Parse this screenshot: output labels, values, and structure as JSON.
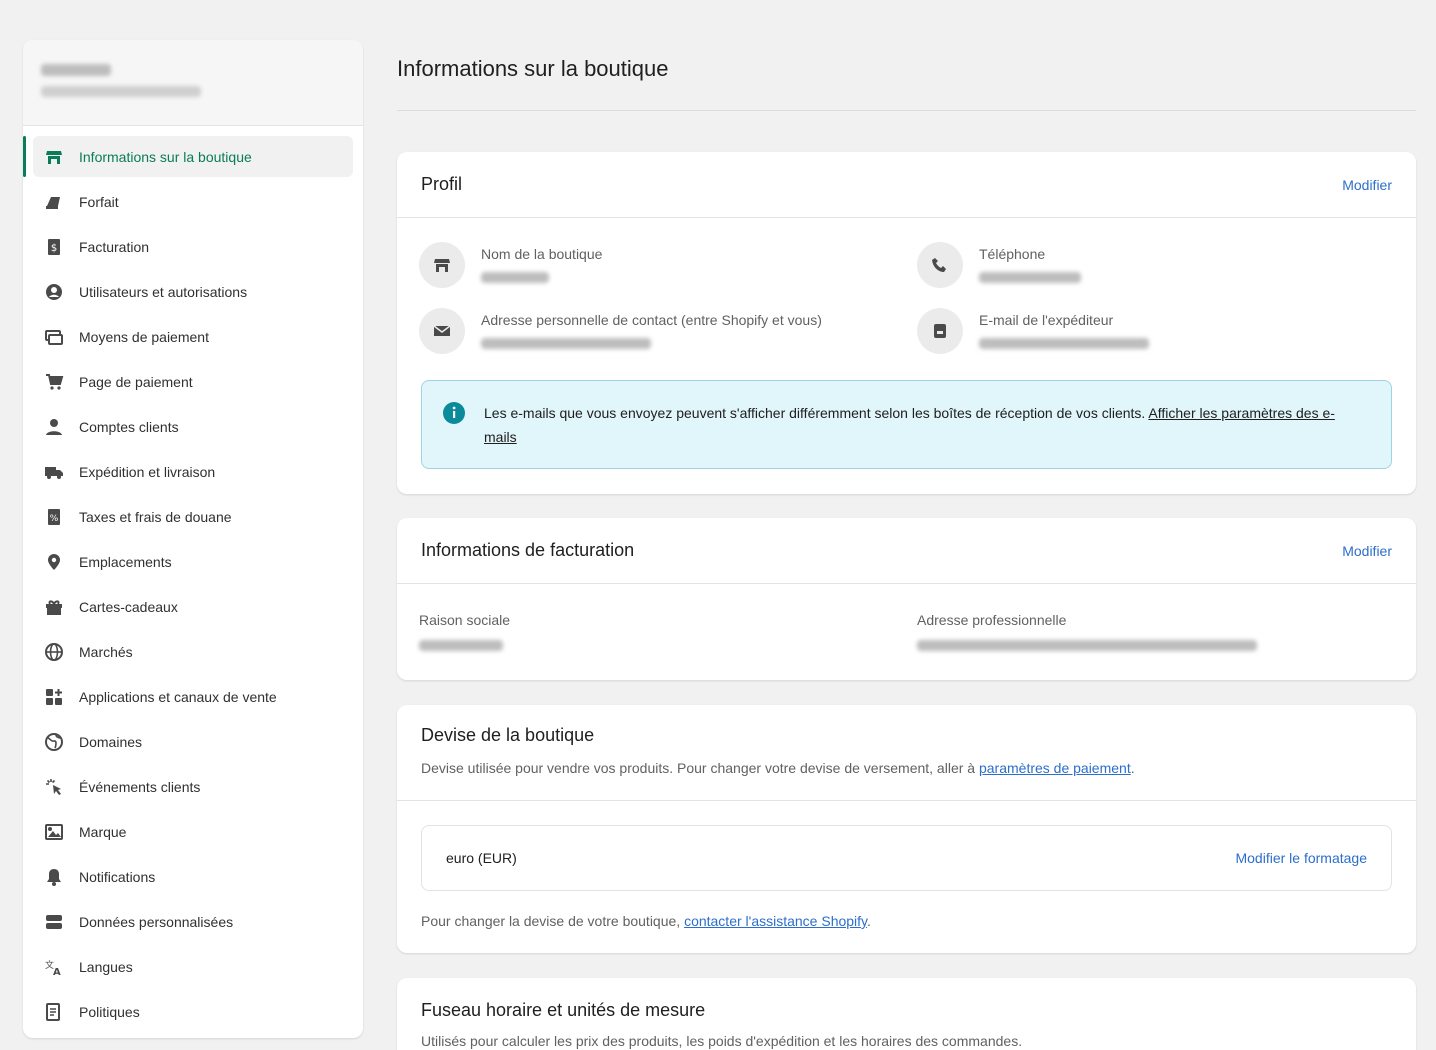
{
  "sidebar": {
    "items": [
      {
        "label": "Informations sur la boutique",
        "icon": "store-icon",
        "active": true
      },
      {
        "label": "Forfait",
        "icon": "plan-icon"
      },
      {
        "label": "Facturation",
        "icon": "billing-icon"
      },
      {
        "label": "Utilisateurs et autorisations",
        "icon": "user-circle-icon"
      },
      {
        "label": "Moyens de paiement",
        "icon": "payment-icon"
      },
      {
        "label": "Page de paiement",
        "icon": "cart-icon"
      },
      {
        "label": "Comptes clients",
        "icon": "person-icon"
      },
      {
        "label": "Expédition et livraison",
        "icon": "truck-icon"
      },
      {
        "label": "Taxes et frais de douane",
        "icon": "tax-icon"
      },
      {
        "label": "Emplacements",
        "icon": "location-icon"
      },
      {
        "label": "Cartes-cadeaux",
        "icon": "gift-icon"
      },
      {
        "label": "Marchés",
        "icon": "globe-icon"
      },
      {
        "label": "Applications et canaux de vente",
        "icon": "apps-icon"
      },
      {
        "label": "Domaines",
        "icon": "domain-globe-icon"
      },
      {
        "label": "Événements clients",
        "icon": "cursor-click-icon"
      },
      {
        "label": "Marque",
        "icon": "brand-icon"
      },
      {
        "label": "Notifications",
        "icon": "bell-icon"
      },
      {
        "label": "Données personnalisées",
        "icon": "database-icon"
      },
      {
        "label": "Langues",
        "icon": "language-icon"
      },
      {
        "label": "Politiques",
        "icon": "policy-icon"
      }
    ]
  },
  "page": {
    "title": "Informations sur la boutique"
  },
  "profile": {
    "title": "Profil",
    "edit": "Modifier",
    "store_name_label": "Nom de la boutique",
    "phone_label": "Téléphone",
    "contact_label": "Adresse personnelle de contact (entre Shopify et vous)",
    "sender_label": "E-mail de l'expéditeur",
    "banner_text": "Les e-mails que vous envoyez peuvent s'afficher différemment selon les boîtes de réception de vos clients. ",
    "banner_link": "Afficher les paramètres des e-mails"
  },
  "billing": {
    "title": "Informations de facturation",
    "edit": "Modifier",
    "company_label": "Raison sociale",
    "address_label": "Adresse professionnelle"
  },
  "currency": {
    "title": "Devise de la boutique",
    "sub_text": "Devise utilisée pour vendre vos produits. Pour changer votre devise de versement, aller à ",
    "sub_link": "paramètres de paiement",
    "sub_end": ".",
    "value": "euro (EUR)",
    "format_link": "Modifier le formatage",
    "note_text": "Pour changer la devise de votre boutique, ",
    "note_link": "contacter l'assistance Shopify",
    "note_end": "."
  },
  "timezone": {
    "title": "Fuseau horaire et unités de mesure",
    "sub": "Utilisés pour calculer les prix des produits, les poids d'expédition et les horaires des commandes."
  },
  "colors": {
    "accent": "#0a7c59",
    "link": "#2c6ecb",
    "banner_bg": "#e0f6fb"
  }
}
